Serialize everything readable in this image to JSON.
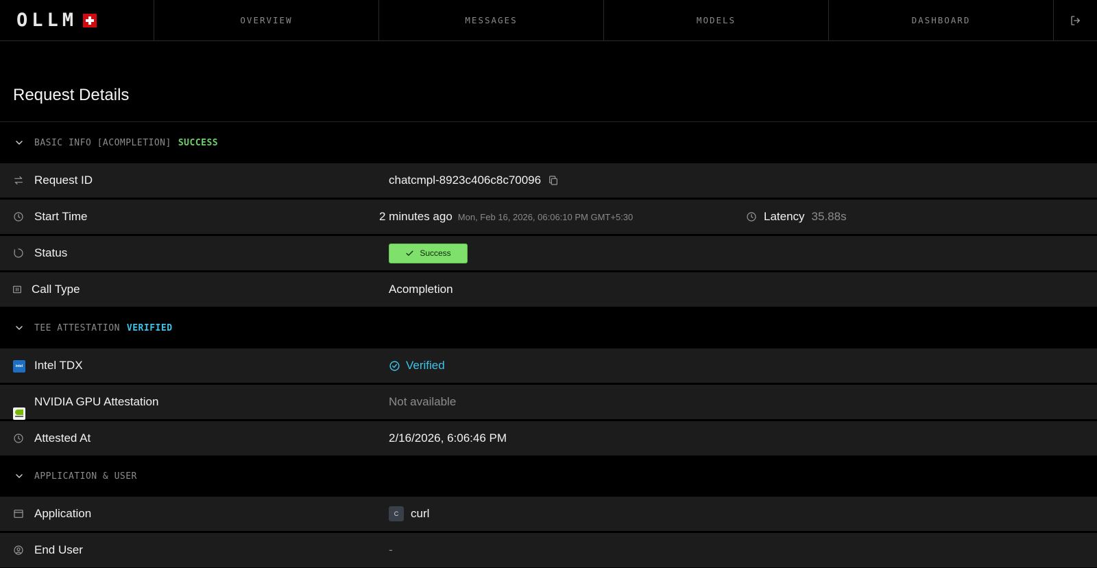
{
  "nav": {
    "logo_text": "OLLM",
    "tabs": [
      "OVERVIEW",
      "MESSAGES",
      "MODELS",
      "DASHBOARD"
    ]
  },
  "page": {
    "title": "Request Details"
  },
  "basic_info": {
    "label": "BASIC INFO [ACOMPLETION]",
    "status": "SUCCESS",
    "request_id_label": "Request ID",
    "request_id_value": "chatcmpl-8923c406c8c70096",
    "start_time_label": "Start Time",
    "start_time_relative": "2 minutes ago",
    "start_time_absolute": "Mon, Feb 16, 2026, 06:06:10 PM GMT+5:30",
    "latency_label": "Latency",
    "latency_value": "35.88s",
    "status_label": "Status",
    "status_value": "Success",
    "call_type_label": "Call Type",
    "call_type_value": "Acompletion"
  },
  "tee": {
    "label": "TEE ATTESTATION",
    "status": "VERIFIED",
    "intel_label": "Intel TDX",
    "intel_logo_text": "intel",
    "intel_value": "Verified",
    "nvidia_label": "NVIDIA GPU Attestation",
    "nvidia_value": "Not available",
    "attested_label": "Attested At",
    "attested_value": "2/16/2026, 6:06:46 PM"
  },
  "app_user": {
    "label": "APPLICATION & USER",
    "application_label": "Application",
    "application_avatar": "C",
    "application_value": "curl",
    "end_user_label": "End User",
    "end_user_value": "-"
  },
  "colors": {
    "success": "#6fd26a",
    "verified": "#3ec3e8",
    "badge_bg": "#7fe06c",
    "row_bg": "#1c1c1c"
  }
}
